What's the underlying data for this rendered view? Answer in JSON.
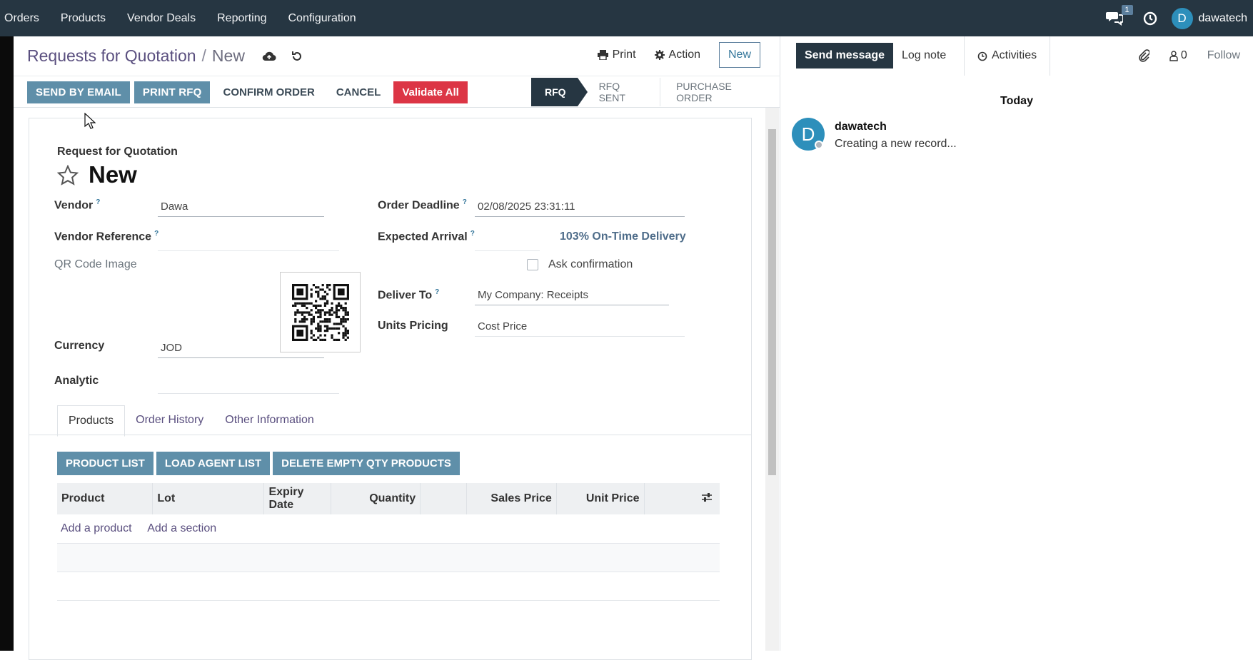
{
  "topnav": {
    "menu": [
      "Orders",
      "Products",
      "Vendor Deals",
      "Reporting",
      "Configuration"
    ],
    "chat_count": "1",
    "user_initial": "D",
    "user_name": "dawatech"
  },
  "breadcrumb": {
    "parent": "Requests for Quotation",
    "separator": "/",
    "current": "New"
  },
  "top_actions": {
    "print": "Print",
    "action": "Action",
    "new": "New"
  },
  "action_buttons": {
    "send_by_email": "SEND BY EMAIL",
    "print_rfq": "PRINT RFQ",
    "confirm_order": "CONFIRM ORDER",
    "cancel": "CANCEL",
    "validate_all": "Validate All"
  },
  "status_steps": [
    "RFQ",
    "RFQ SENT",
    "PURCHASE ORDER"
  ],
  "status_active": "RFQ",
  "document": {
    "type_label": "Request for Quotation",
    "name": "New"
  },
  "fields": {
    "vendor_label": "Vendor",
    "vendor_value": "Dawa",
    "vendor_ref_label": "Vendor Reference",
    "vendor_ref_value": "",
    "qr_label": "QR Code Image",
    "currency_label": "Currency",
    "currency_value": "JOD",
    "analytic_label": "Analytic",
    "analytic_value": "",
    "order_deadline_label": "Order Deadline",
    "order_deadline_value": "02/08/2025 23:31:11",
    "expected_arrival_label": "Expected Arrival",
    "expected_arrival_value": "",
    "on_time_delivery": "103% On-Time Delivery",
    "ask_confirmation_label": "Ask confirmation",
    "deliver_to_label": "Deliver To",
    "deliver_to_value": "My Company: Receipts",
    "units_pricing_label": "Units Pricing",
    "units_pricing_value": "Cost Price",
    "help_marker": "?"
  },
  "tabs": [
    "Products",
    "Order History",
    "Other Information"
  ],
  "list_buttons": [
    "PRODUCT LIST",
    "LOAD AGENT LIST",
    "DELETE EMPTY QTY PRODUCTS"
  ],
  "table": {
    "columns": [
      "Product",
      "Lot",
      "Expiry Date",
      "Quantity",
      "",
      "Sales Price",
      "Unit Price"
    ],
    "add_product": "Add a product",
    "add_section": "Add a section"
  },
  "chatter": {
    "send_message": "Send message",
    "log_note": "Log note",
    "activities": "Activities",
    "followers_count": "0",
    "follow": "Follow",
    "date_separator": "Today",
    "message": {
      "author_initial": "D",
      "author": "dawatech",
      "body": "Creating a new record..."
    }
  },
  "colors": {
    "navbar": "#263642",
    "primary_button": "#5f8fa9",
    "danger_button": "#dc3545",
    "link": "#5a4f7f"
  }
}
